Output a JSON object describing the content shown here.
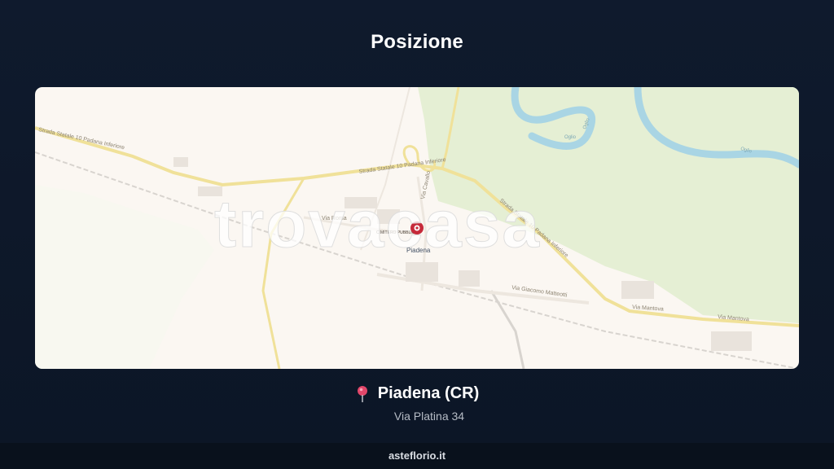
{
  "header": {
    "title": "Posizione"
  },
  "map": {
    "watermark": "trovacasa",
    "town_label": "Piadena",
    "place_label": "CIMITERO PUBBLICO",
    "roads": {
      "ss10_west": "Strada Statale 10 Padana Inferiore",
      "ss10_north": "Strada Statale 10 Padana Inferiore",
      "ss10_east": "Strada Statale 10 Padana Inferiore",
      "via_roma": "Via Roma",
      "via_cavallo": "Via Cavallo",
      "via_matteotti": "Via Giacomo Matteotti",
      "via_mantova_1": "Via Mantova",
      "via_mantova_2": "Via Mantova",
      "river_1": "Oglio",
      "river_2": "Oglio",
      "river_3": "Oglio"
    },
    "colors": {
      "land": "#fbf7f2",
      "park": "#e6f0d6",
      "water": "#a9d7e6",
      "major_road": "#f1e3a0",
      "marker": "#c62a3a"
    }
  },
  "location": {
    "pin_icon": "map-pin-icon",
    "city": "Piadena (CR)",
    "address": "Via Platina 34"
  },
  "footer": {
    "brand": "asteflorio.it"
  }
}
